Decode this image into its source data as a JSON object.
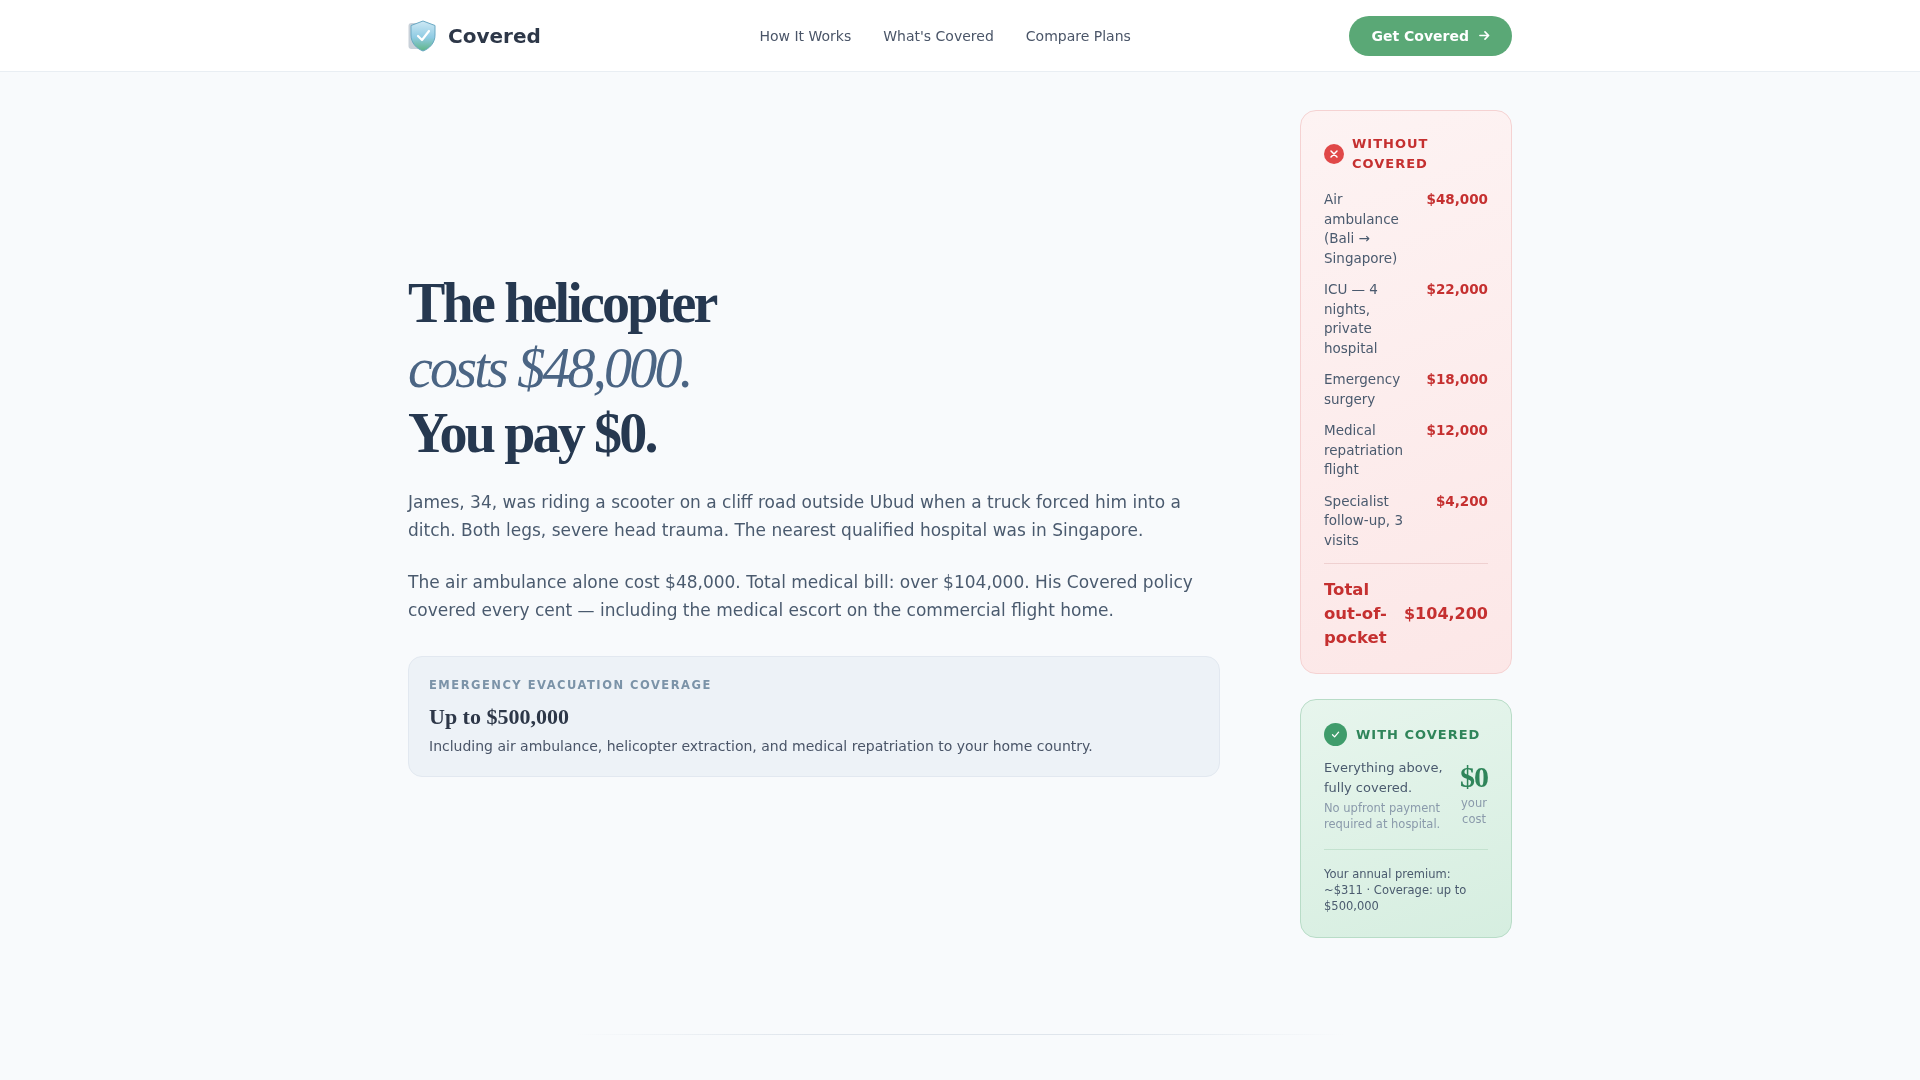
{
  "header": {
    "brand": "Covered",
    "nav": [
      "How It Works",
      "What's Covered",
      "Compare Plans"
    ],
    "cta": "Get Covered"
  },
  "story": {
    "headline": [
      {
        "text": "The helicopter",
        "kind": "bold"
      },
      {
        "text": "costs $48,000.",
        "kind": "italic"
      },
      {
        "text": "You pay $0.",
        "kind": "bold"
      }
    ],
    "paragraphs": [
      "James, 34, was riding a scooter on a cliff road outside Ubud when a truck forced him into a ditch. Both legs, severe head trauma. The nearest qualified hospital was in Singapore.",
      "The air ambulance alone cost $48,000. Total medical bill: over $104,000. His Covered policy covered every cent — including the medical escort on the commercial flight home."
    ],
    "coverage": {
      "label": "EMERGENCY EVACUATION COVERAGE",
      "amount": "Up to $500,000",
      "description": "Including air ambulance, helicopter extraction, and medical repatriation to your home country."
    }
  },
  "without_covered": {
    "title": "WITHOUT COVERED",
    "items": [
      {
        "label": "Air ambulance (Bali → Singapore)",
        "amount": "$48,000"
      },
      {
        "label": "ICU — 4 nights, private hospital",
        "amount": "$22,000"
      },
      {
        "label": "Emergency surgery",
        "amount": "$18,000"
      },
      {
        "label": "Medical repatriation flight",
        "amount": "$12,000"
      },
      {
        "label": "Specialist follow-up, 3 visits",
        "amount": "$4,200"
      }
    ],
    "total_label": "Total out-of-pocket",
    "total": "$104,200"
  },
  "with_covered": {
    "title": "WITH COVERED",
    "summary": "Everything above, fully covered.",
    "note": "No upfront payment required at hospital.",
    "cost": "$0",
    "cost_caption": "your cost",
    "premium": "Your annual premium: ~$311 · Coverage: up to $500,000"
  }
}
